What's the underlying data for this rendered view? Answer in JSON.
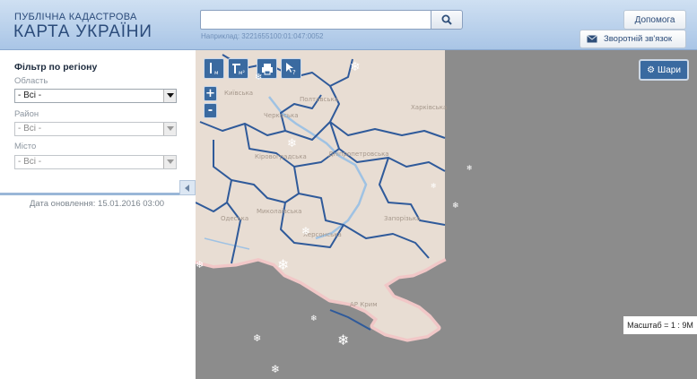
{
  "header": {
    "brand_line1": "ПУБЛІЧНА КАДАСТРОВА",
    "brand_line2": "КАРТА УКРАЇНИ",
    "search": {
      "value": "",
      "placeholder": "",
      "hint": "Наприклад: 3221655100:01:047:0052"
    },
    "help_label": "Допомога",
    "feedback_label": "Зворотній зв'язок",
    "feedback_icon": "envelope-icon",
    "search_icon": "magnifier-icon"
  },
  "sidebar": {
    "filter_title": "Фільтр по регіону",
    "oblast": {
      "label": "Область",
      "value": "- Всі -"
    },
    "raion": {
      "label": "Район",
      "value": "- Всі -"
    },
    "city": {
      "label": "Місто",
      "value": "- Всі -"
    },
    "update_date": "Дата оновлення: 15.01.2016 03:00"
  },
  "map": {
    "tools": [
      {
        "name": "measure-line-icon",
        "sub": "м"
      },
      {
        "name": "measure-area-icon",
        "sub": "м²"
      },
      {
        "name": "print-icon",
        "sub": ""
      },
      {
        "name": "identify-cursor-icon",
        "sub": "?"
      }
    ],
    "zoom_in": "+",
    "zoom_out": "-",
    "layers_label": "Шари",
    "scale_text": "Масштаб = 1 : 9M",
    "regions": [
      "Київська",
      "Полтавська",
      "Черкаська",
      "Харківська",
      "Кіровоградська",
      "Дніпропетровська",
      "Миколаївська",
      "Одеська",
      "Запорізька",
      "Херсонська",
      "АР Крим"
    ],
    "colors": {
      "sea": "#8c8c8c",
      "land": "#e8ddd3",
      "border": "#2f5a9a",
      "coast": "#f1c7c7"
    }
  }
}
